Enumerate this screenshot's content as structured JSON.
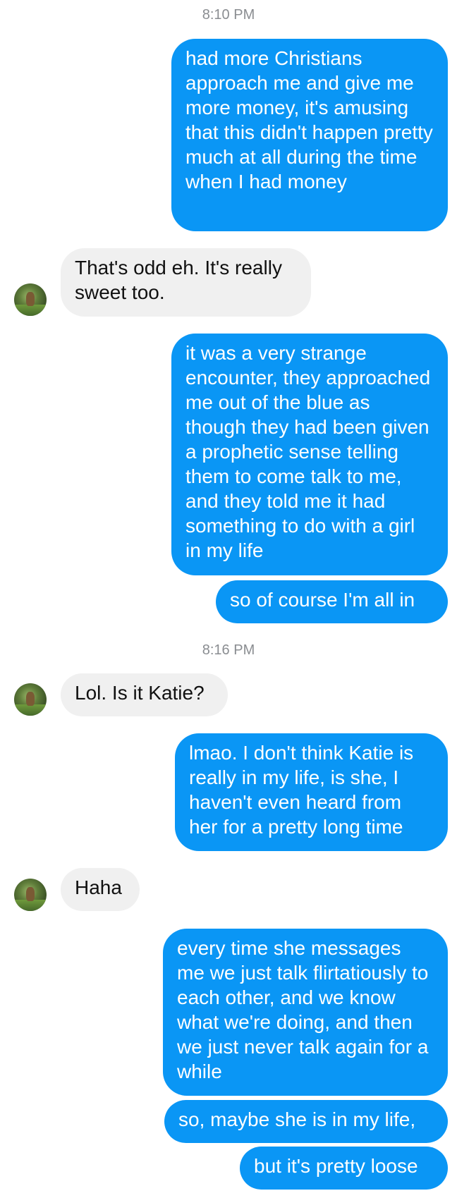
{
  "colors": {
    "outgoing": "#0a96f5",
    "incoming": "#f0f0f0",
    "timestamp": "#8a8d91"
  },
  "thread": {
    "timestamps": [
      "8:10 PM",
      "8:16 PM"
    ],
    "messages": [
      {
        "from": "me",
        "text": "had more Christians approach me and give me more money, it's amusing that this didn't happen pretty much at all during the time when I had money"
      },
      {
        "from": "them",
        "text": "That's odd eh. It's really sweet too."
      },
      {
        "from": "me",
        "text": "it was a very strange encounter, they approached me out of the blue as though they had been given a prophetic sense telling them to come talk to me, and they told me it had something to do with a girl in my life"
      },
      {
        "from": "me",
        "text": "so of course I'm all in"
      },
      {
        "from": "them",
        "text": "Lol. Is it Katie?"
      },
      {
        "from": "me",
        "text": "lmao. I don't think Katie is really in my life, is she, I haven't even heard from her for a pretty long time"
      },
      {
        "from": "them",
        "text": "Haha"
      },
      {
        "from": "me",
        "text": "every time she messages me we just talk flirtatiously to each other, and we know what we're doing, and then we just never talk again for a while"
      },
      {
        "from": "me",
        "text": "so, maybe she is in my life,"
      },
      {
        "from": "me",
        "text": "but it's pretty loose"
      }
    ],
    "avatar_icon": "contact-avatar-photo"
  }
}
